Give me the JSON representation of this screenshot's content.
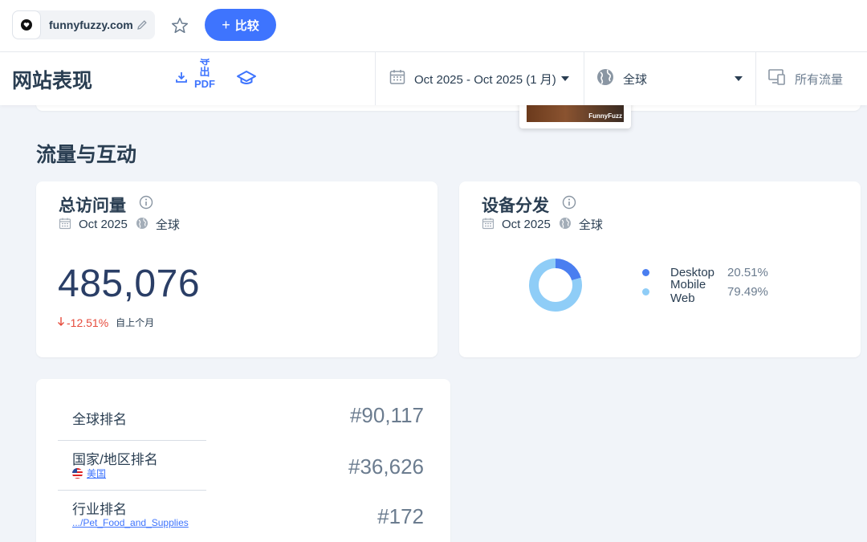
{
  "header": {
    "site": "funnyfuzzy.com",
    "compare_label": "比较"
  },
  "toolbar": {
    "page_title": "网站表现",
    "pdf_line1": "导",
    "pdf_line2": "出",
    "pdf_line3": "PDF",
    "date_range": "Oct 2025 - Oct 2025 (1 月)",
    "region": "全球",
    "traffic_type": "所有流量"
  },
  "thumbnail": {
    "caption": "FunnyFuzz"
  },
  "section": {
    "title": "流量与互动"
  },
  "visits_card": {
    "title": "总访问量",
    "month": "Oct 2025",
    "region": "全球",
    "total": "485,076",
    "change": "-12.51%",
    "change_label": "自上个月"
  },
  "device_card": {
    "title": "设备分发",
    "month": "Oct 2025",
    "region": "全球",
    "segments": [
      {
        "name": "Desktop",
        "value": "20.51%",
        "share": 20.51,
        "color": "#4a7ef0"
      },
      {
        "name": "Mobile Web",
        "value": "79.49%",
        "share": 79.49,
        "color": "#8fcdf7"
      }
    ]
  },
  "rank_card": {
    "global_label": "全球排名",
    "global_value": "#90,117",
    "country_label": "国家/地区排名",
    "country_link": "美国",
    "country_value": "#36,626",
    "industry_label": "行业排名",
    "industry_link": ".../Pet_Food_and_Supplies",
    "industry_value": "#172"
  },
  "colors": {
    "accent": "#3e74fe",
    "negative": "#e64b3c"
  }
}
